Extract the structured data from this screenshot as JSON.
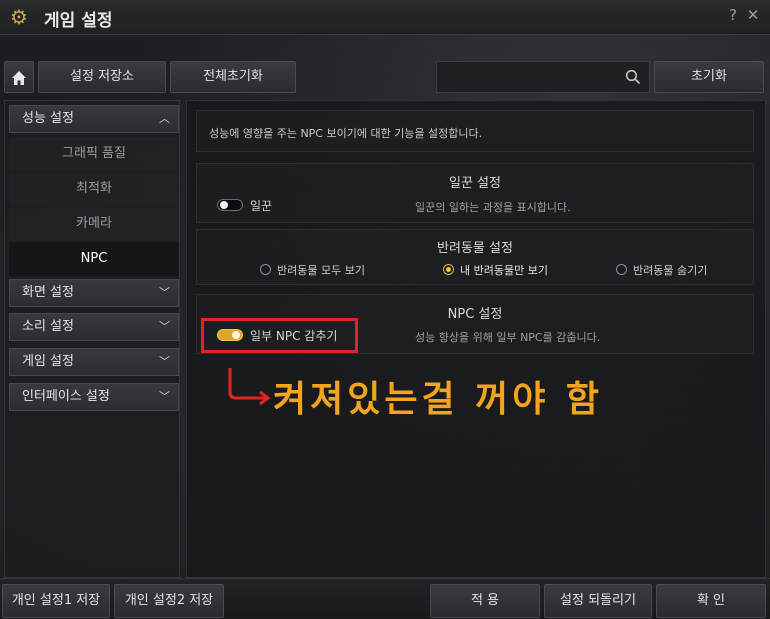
{
  "window": {
    "title": "게임 설정",
    "help_label": "?",
    "close_label": "✕"
  },
  "toolbar": {
    "save_store_label": "설정 저장소",
    "reset_all_label": "전체초기화",
    "search_placeholder": "",
    "reset_label": "초기화"
  },
  "sidebar": {
    "categories": [
      {
        "label": "성능 설정",
        "expanded": true
      },
      {
        "label": "화면 설정",
        "expanded": false
      },
      {
        "label": "소리 설정",
        "expanded": false
      },
      {
        "label": "게임 설정",
        "expanded": false
      },
      {
        "label": "인터페이스 설정",
        "expanded": false
      }
    ],
    "sub_items": [
      "그래픽 품질",
      "최적화",
      "카메라",
      "NPC"
    ],
    "active_sub_item": "NPC"
  },
  "main": {
    "description": "성능에 영향을 주는 NPC 보이기에 대한 기능을 설정합니다.",
    "worker": {
      "title": "일꾼 설정",
      "toggle_label": "일꾼",
      "toggle_on": false,
      "detail": "일꾼의 일하는 과정을 표시합니다."
    },
    "pet": {
      "title": "반려동물 설정",
      "options": [
        "반려동물 모두 보기",
        "내 반려동물만 보기",
        "반려동물 숨기기"
      ],
      "selected_index": 1
    },
    "npc": {
      "title": "NPC 설정",
      "toggle_label": "일부 NPC 감추기",
      "toggle_on": true,
      "detail": "성능 향상을 위해 일부 NPC를 감춥니다."
    }
  },
  "annotation": {
    "text": "켜져있는걸 꺼야 함",
    "color": "#f2a51c",
    "box_color": "#e32222"
  },
  "bottom": {
    "personal_save_1": "개인 설정1 저장",
    "personal_save_2": "개인 설정2 저장",
    "apply": "적 용",
    "revert": "설정 되돌리기",
    "confirm": "확 인"
  },
  "colors": {
    "accent": "#d9a92c",
    "background": "#17181b"
  }
}
